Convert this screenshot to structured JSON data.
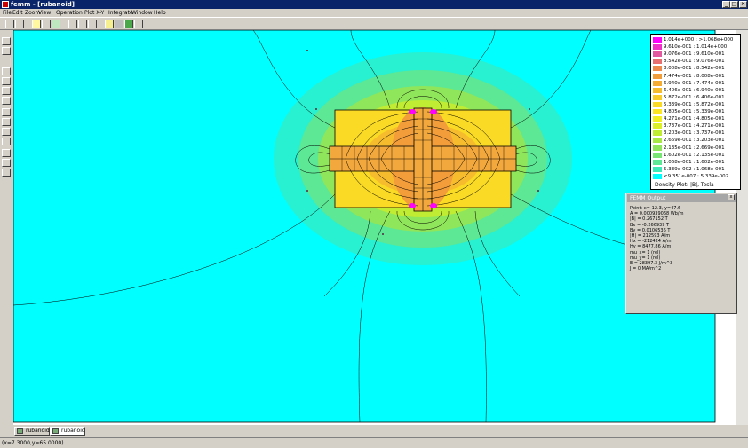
{
  "window": {
    "title": "femm - [rubanoid]"
  },
  "menu": [
    "File",
    "Edit",
    "Zoom",
    "View",
    "Operation",
    "Plot X-Y",
    "Integrate",
    "Window",
    "Help"
  ],
  "legend": {
    "entries": [
      {
        "label": "1.014e+000 : >1.068e+000",
        "color": "#ff00ff"
      },
      {
        "label": "9.610e-001 : 1.014e+000",
        "color": "#f030c8"
      },
      {
        "label": "9.076e-001 : 9.610e-001",
        "color": "#e45aa0"
      },
      {
        "label": "8.542e-001 : 9.076e-001",
        "color": "#e87070"
      },
      {
        "label": "8.008e-001 : 8.542e-001",
        "color": "#ee8a4c"
      },
      {
        "label": "7.474e-001 : 8.008e-001",
        "color": "#f29c3a"
      },
      {
        "label": "6.940e-001 : 7.474e-001",
        "color": "#f4ac32"
      },
      {
        "label": "6.406e-001 : 6.940e-001",
        "color": "#f6bc2e"
      },
      {
        "label": "5.872e-001 : 6.406e-001",
        "color": "#f8cc2a"
      },
      {
        "label": "5.339e-001 : 5.872e-001",
        "color": "#fada24"
      },
      {
        "label": "4.805e-001 : 5.339e-001",
        "color": "#fce622"
      },
      {
        "label": "4.271e-001 : 4.805e-001",
        "color": "#f2f020"
      },
      {
        "label": "3.737e-001 : 4.271e-001",
        "color": "#dcf028"
      },
      {
        "label": "3.203e-001 : 3.737e-001",
        "color": "#c0ec34"
      },
      {
        "label": "2.669e-001 : 3.203e-001",
        "color": "#a8e844"
      },
      {
        "label": "2.135e-001 : 2.669e-001",
        "color": "#90e65a"
      },
      {
        "label": "1.602e-001 : 2.135e-001",
        "color": "#78e674"
      },
      {
        "label": "1.068e-001 : 1.602e-001",
        "color": "#5ce894"
      },
      {
        "label": "5.339e-002 : 1.068e-001",
        "color": "#3ceab8"
      },
      {
        "label": "<9.351e-007 : 5.339e-002",
        "color": "#00ffff"
      }
    ],
    "title": "Density Plot: |B|, Tesla"
  },
  "output": {
    "title": "FEMM Output",
    "close": "x",
    "lines": [
      "Point: x=-12.3, y=47.6",
      "A   = 0.000939068 Wb/m",
      "|B| = 0.267152 T",
      "Bx  = -0.266939 T",
      "By  = 0.0106536 T",
      "|H| = 212593 A/m",
      "Hx  = -212424 A/m",
      "Hy  = 8477.86 A/m",
      "mu_x= 1 (rel)",
      "mu_y= 1 (rel)",
      "E   = 28397.3 J/m^3",
      "J   = 0 MA/m^2"
    ]
  },
  "tabs": [
    "rubanoid",
    "rubanoid"
  ],
  "status": "(x=7.3000,y=65.0000)",
  "colors": {
    "background_field": "#00ffff",
    "coil": "#f2a83c",
    "titlebar": "#0a246a"
  }
}
